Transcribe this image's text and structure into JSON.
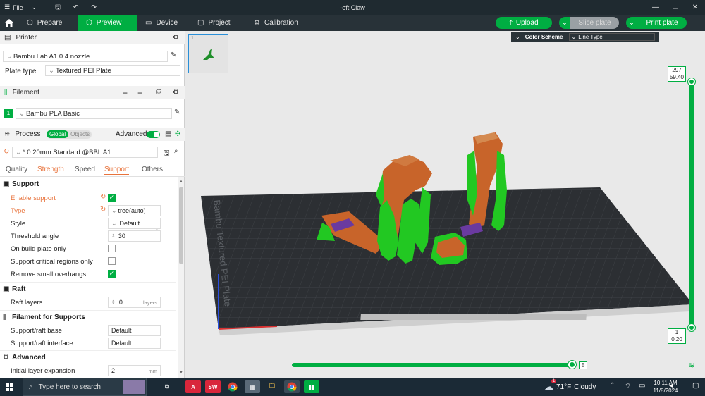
{
  "window": {
    "menu_file": "File",
    "title": "-eft Claw"
  },
  "nav": {
    "tabs": [
      {
        "label": "Prepare"
      },
      {
        "label": "Preview"
      },
      {
        "label": "Device"
      },
      {
        "label": "Project"
      },
      {
        "label": "Calibration"
      }
    ],
    "upload_label": "Upload",
    "slice_label": "Slice plate",
    "print_label": "Print plate"
  },
  "printer": {
    "section_label": "Printer",
    "printer_value": "Bambu Lab A1 0.4 nozzle",
    "plate_type_label": "Plate type",
    "plate_type_value": "Textured PEI Plate"
  },
  "filament": {
    "section_label": "Filament",
    "slot_number": "1",
    "filament_value": "Bambu PLA Basic"
  },
  "process": {
    "section_label": "Process",
    "toggle_global": "Global",
    "toggle_objects": "Objects",
    "advanced_label": "Advanced",
    "profile_value": "* 0.20mm Standard @BBL A1",
    "tabs": [
      "Quality",
      "Strength",
      "Speed",
      "Support",
      "Others"
    ]
  },
  "support": {
    "group_title": "Support",
    "enable_label": "Enable support",
    "type_label": "Type",
    "type_value": "tree(auto)",
    "style_label": "Style",
    "style_value": "Default",
    "threshold_label": "Threshold angle",
    "threshold_value": "30",
    "threshold_unit": "°",
    "build_plate_only_label": "On build plate only",
    "critical_regions_label": "Support critical regions only",
    "remove_overhangs_label": "Remove small overhangs",
    "enable_checked": true,
    "remove_overhangs_checked": true
  },
  "raft": {
    "group_title": "Raft",
    "layers_label": "Raft layers",
    "layers_value": "0",
    "layers_unit": "layers"
  },
  "filament_supports": {
    "group_title": "Filament for Supports",
    "base_label": "Support/raft base",
    "base_value": "Default",
    "interface_label": "Support/raft interface",
    "interface_value": "Default"
  },
  "advanced": {
    "group_title": "Advanced",
    "expansion_label": "Initial layer expansion",
    "expansion_value": "2",
    "expansion_unit": "mm"
  },
  "viewport": {
    "color_scheme_label": "Color Scheme",
    "color_scheme_value": "Line Type",
    "plate_text": "Bambu Textured PEI Plate",
    "layer_top_num": "297",
    "layer_top_height": "59.40",
    "layer_bottom_num": "1",
    "layer_bottom_height": "0.20",
    "move_value": "5",
    "layer_slider_fraction": 1.0,
    "move_slider_fraction": 1.0,
    "plate_number": "1"
  },
  "taskbar": {
    "search_placeholder": "Type here to search",
    "weather_temp": "71°F",
    "weather_cond": "Cloudy",
    "time": "10:11 AM",
    "date": "11/8/2024",
    "weather_badge": "1"
  },
  "colors": {
    "accent": "#00ae42",
    "nav_bg": "#283238",
    "title_bg": "#1f2a30",
    "support_green": "#1fc41f",
    "model_orange": "#c8642a",
    "bed_dark": "#2a2d31"
  }
}
